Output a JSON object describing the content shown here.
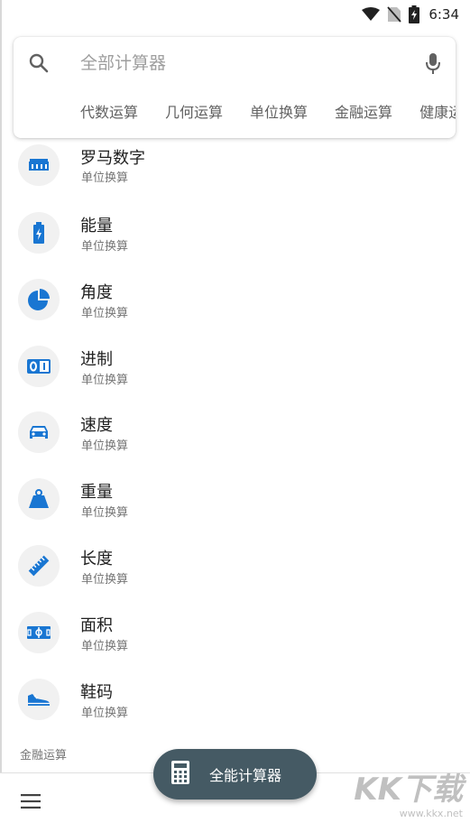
{
  "status_bar": {
    "time": "6:34",
    "icons": [
      "wifi-icon",
      "no-sim-icon",
      "battery-charging-icon"
    ]
  },
  "search": {
    "placeholder": "全部计算器",
    "icon": "search-icon",
    "mic_icon": "mic-icon"
  },
  "chips": [
    {
      "label": "代数运算"
    },
    {
      "label": "几何运算"
    },
    {
      "label": "单位换算"
    },
    {
      "label": "金融运算"
    },
    {
      "label": "健康运算"
    }
  ],
  "list": [
    {
      "title": "罗马数字",
      "subtitle": "单位换算",
      "icon": "roman-numerals-icon"
    },
    {
      "title": "能量",
      "subtitle": "单位换算",
      "icon": "battery-icon"
    },
    {
      "title": "角度",
      "subtitle": "单位换算",
      "icon": "pie-chart-icon"
    },
    {
      "title": "进制",
      "subtitle": "单位换算",
      "icon": "binary-icon"
    },
    {
      "title": "速度",
      "subtitle": "单位换算",
      "icon": "car-icon"
    },
    {
      "title": "重量",
      "subtitle": "单位换算",
      "icon": "weight-icon"
    },
    {
      "title": "长度",
      "subtitle": "单位换算",
      "icon": "ruler-icon"
    },
    {
      "title": "面积",
      "subtitle": "单位换算",
      "icon": "area-icon"
    },
    {
      "title": "鞋码",
      "subtitle": "单位换算",
      "icon": "shoe-icon"
    }
  ],
  "section_header": "金融运算",
  "fab": {
    "label": "全能计算器",
    "icon": "calculator-icon"
  },
  "bottom_bar": {
    "menu_icon": "menu-icon"
  },
  "watermark": {
    "big": "KK下载",
    "small": "www.kkx.net"
  },
  "colors": {
    "accent": "#1976d2",
    "fab_background": "#455a64",
    "icon_circle": "#f1f1f1"
  }
}
